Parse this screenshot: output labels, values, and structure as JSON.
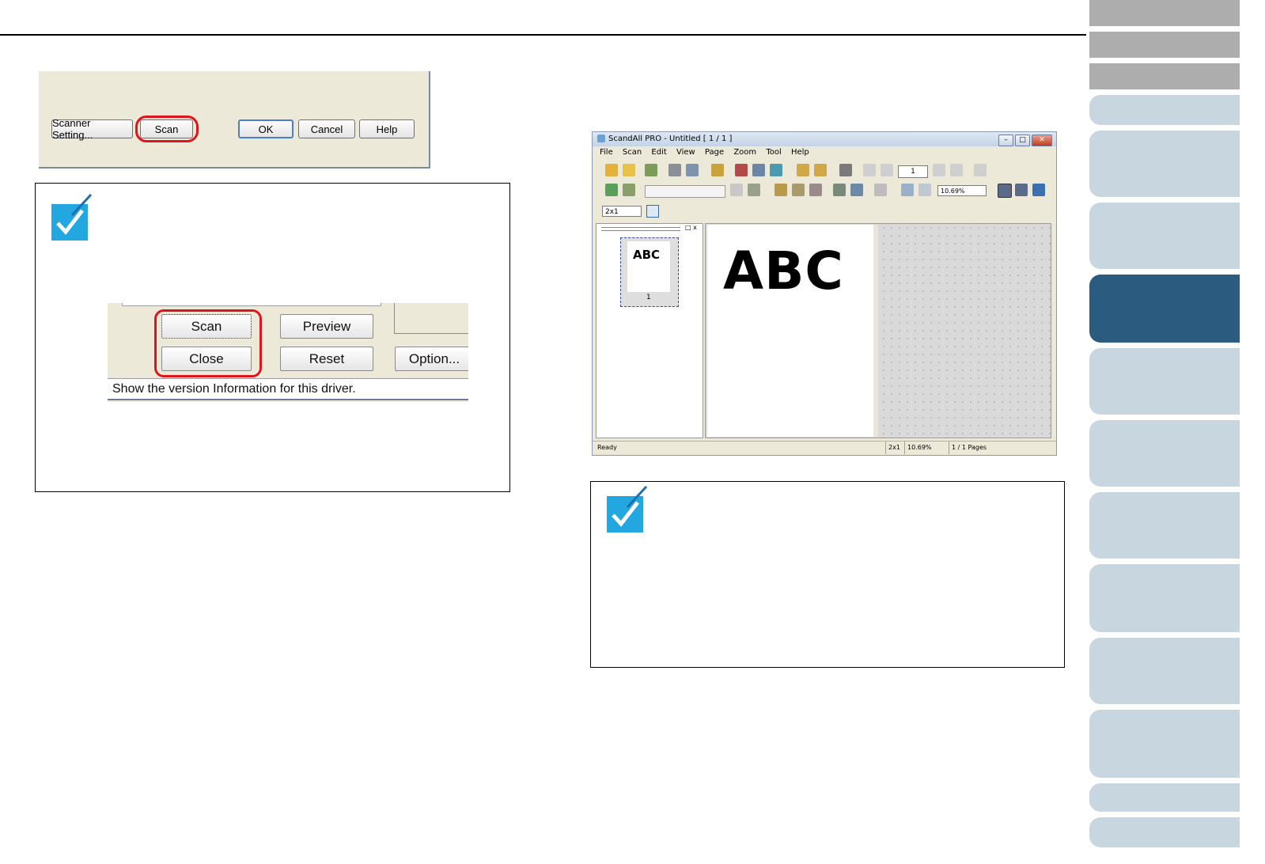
{
  "dialog1": {
    "buttons": [
      "Scanner Setting...",
      "Scan",
      "OK",
      "Cancel",
      "Help"
    ]
  },
  "dialog2": {
    "buttons": [
      "Scan",
      "Preview",
      "Close",
      "Reset",
      "Option..."
    ],
    "status": "Show the version Information for this driver."
  },
  "scandall": {
    "title": "ScandAll PRO - Untitled  [ 1 / 1 ]",
    "menu": [
      "File",
      "Scan",
      "Edit",
      "View",
      "Page",
      "Zoom",
      "Tool",
      "Help"
    ],
    "page_number": "1",
    "zoom": "10.69%",
    "layout": "2x1",
    "thumb_text": "ABC",
    "thumb_index": "1",
    "document_text": "ABC",
    "status": {
      "ready": "Ready",
      "layout": "2x1",
      "zoom": "10.69%",
      "pages": "1 / 1 Pages"
    }
  },
  "colors": {
    "highlight": "#e0141c",
    "check_icon": "#22a7e0",
    "tab_active": "#2b5b7e",
    "tab_inactive": "#c7d6df",
    "tab_gray": "#adadad"
  }
}
